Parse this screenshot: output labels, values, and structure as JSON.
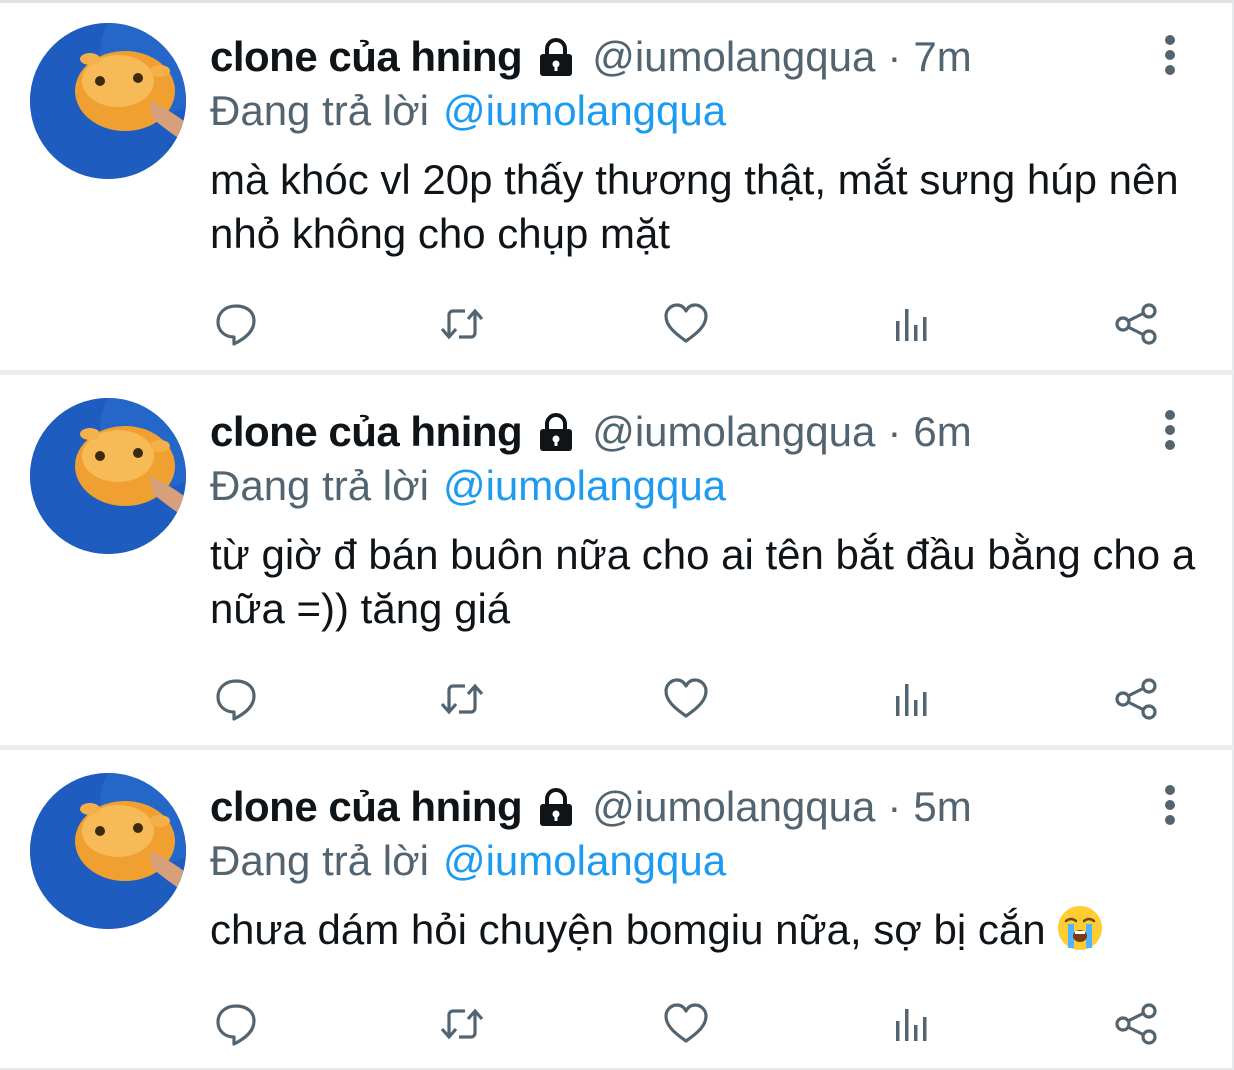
{
  "tweets": [
    {
      "name": "clone của hning",
      "handle": "@iumolangqua",
      "time": "7m",
      "reply_prefix": "Đang trả lời",
      "reply_to": "@iumolangqua",
      "text": "mà khóc vl 20p thấy thương thật, mắt sưng húp nên nhỏ không cho chụp mặt"
    },
    {
      "name": "clone của hning",
      "handle": "@iumolangqua",
      "time": "6m",
      "reply_prefix": "Đang trả lời",
      "reply_to": "@iumolangqua",
      "text": "từ giờ đ bán buôn nữa cho ai tên bắt đầu bằng cho a nữa =)) tăng giá"
    },
    {
      "name": "clone của hning",
      "handle": "@iumolangqua",
      "time": "5m",
      "reply_prefix": "Đang trả lời",
      "reply_to": "@iumolangqua",
      "text": "chưa dám hỏi chuyện bomgiu nữa, sợ bị cắn",
      "emoji": "loudly-crying-face"
    }
  ],
  "separator": "·",
  "colors": {
    "text_primary": "#0f1419",
    "text_secondary": "#536471",
    "link": "#1d9bf0",
    "divider": "#e9ecef"
  },
  "icons": {
    "protected": "lock-icon",
    "more": "more-vertical-icon",
    "actions": [
      "reply-icon",
      "retweet-icon",
      "like-icon",
      "views-icon",
      "share-icon"
    ]
  }
}
